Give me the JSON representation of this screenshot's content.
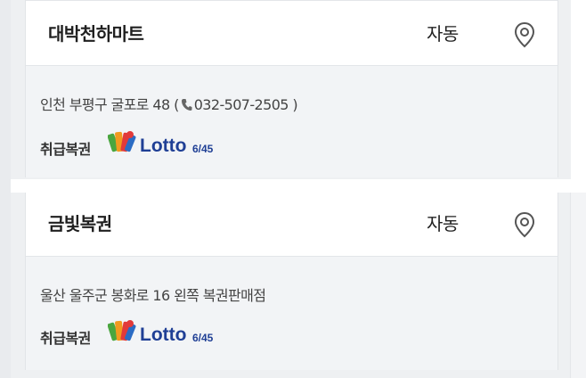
{
  "stores": [
    {
      "name": "대박천하마트",
      "type": "자동",
      "address_prefix": "인천 부평구 굴포로 48 (",
      "phone": "032-507-2505",
      "address_suffix": " )",
      "lottery_label": "취급복권",
      "lottery_logo_icon": "lotto-645-logo",
      "map_icon": "map-pin-icon"
    },
    {
      "name": "금빛복권",
      "type": "자동",
      "address": "울산 울주군 봉화로 16 왼쪽 복권판매점",
      "lottery_label": "취급복권",
      "lottery_logo_icon": "lotto-645-logo",
      "map_icon": "map-pin-icon"
    }
  ],
  "logo_text": "Lotto",
  "logo_sub": "6/45",
  "colors": {
    "logo_blue": "#1f3f95",
    "logo_orange": "#f29a1f",
    "logo_green": "#4aa63f",
    "logo_red": "#e23a3a"
  }
}
